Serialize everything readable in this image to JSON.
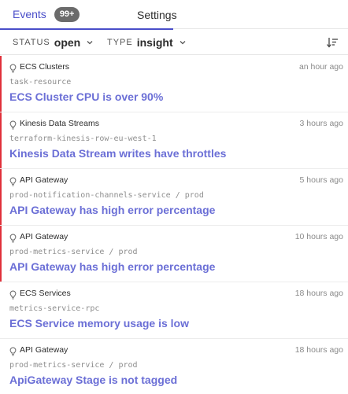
{
  "tabs": {
    "events_label": "Events",
    "events_count": "99+",
    "settings_label": "Settings"
  },
  "filters": {
    "status_label": "STATUS",
    "status_value": "open",
    "type_label": "TYPE",
    "type_value": "insight"
  },
  "events": [
    {
      "source": "ECS Clusters",
      "time": "an hour ago",
      "resource": "task-resource",
      "title": "ECS Cluster CPU is over 90%",
      "urgent": true
    },
    {
      "source": "Kinesis Data Streams",
      "time": "3 hours ago",
      "resource": "terraform-kinesis-row-eu-west-1",
      "title": "Kinesis Data Stream writes have throttles",
      "urgent": true
    },
    {
      "source": "API Gateway",
      "time": "5 hours ago",
      "resource": "prod-notification-channels-service / prod",
      "title": "API Gateway has high error percentage",
      "urgent": true
    },
    {
      "source": "API Gateway",
      "time": "10 hours ago",
      "resource": "prod-metrics-service / prod",
      "title": "API Gateway has high error percentage",
      "urgent": true
    },
    {
      "source": "ECS Services",
      "time": "18 hours ago",
      "resource": "metrics-service-rpc",
      "title": "ECS Service memory usage is low",
      "urgent": false
    },
    {
      "source": "API Gateway",
      "time": "18 hours ago",
      "resource": "prod-metrics-service / prod",
      "title": "ApiGateway Stage is not tagged",
      "urgent": false
    }
  ],
  "colors": {
    "accent": "#4a4ec9",
    "title": "#6b6fd6",
    "urgent": "#e0303a"
  },
  "icons": {
    "event": "lightbulb-icon",
    "filter_dropdown": "chevron-down-icon",
    "sort": "sort-icon"
  }
}
